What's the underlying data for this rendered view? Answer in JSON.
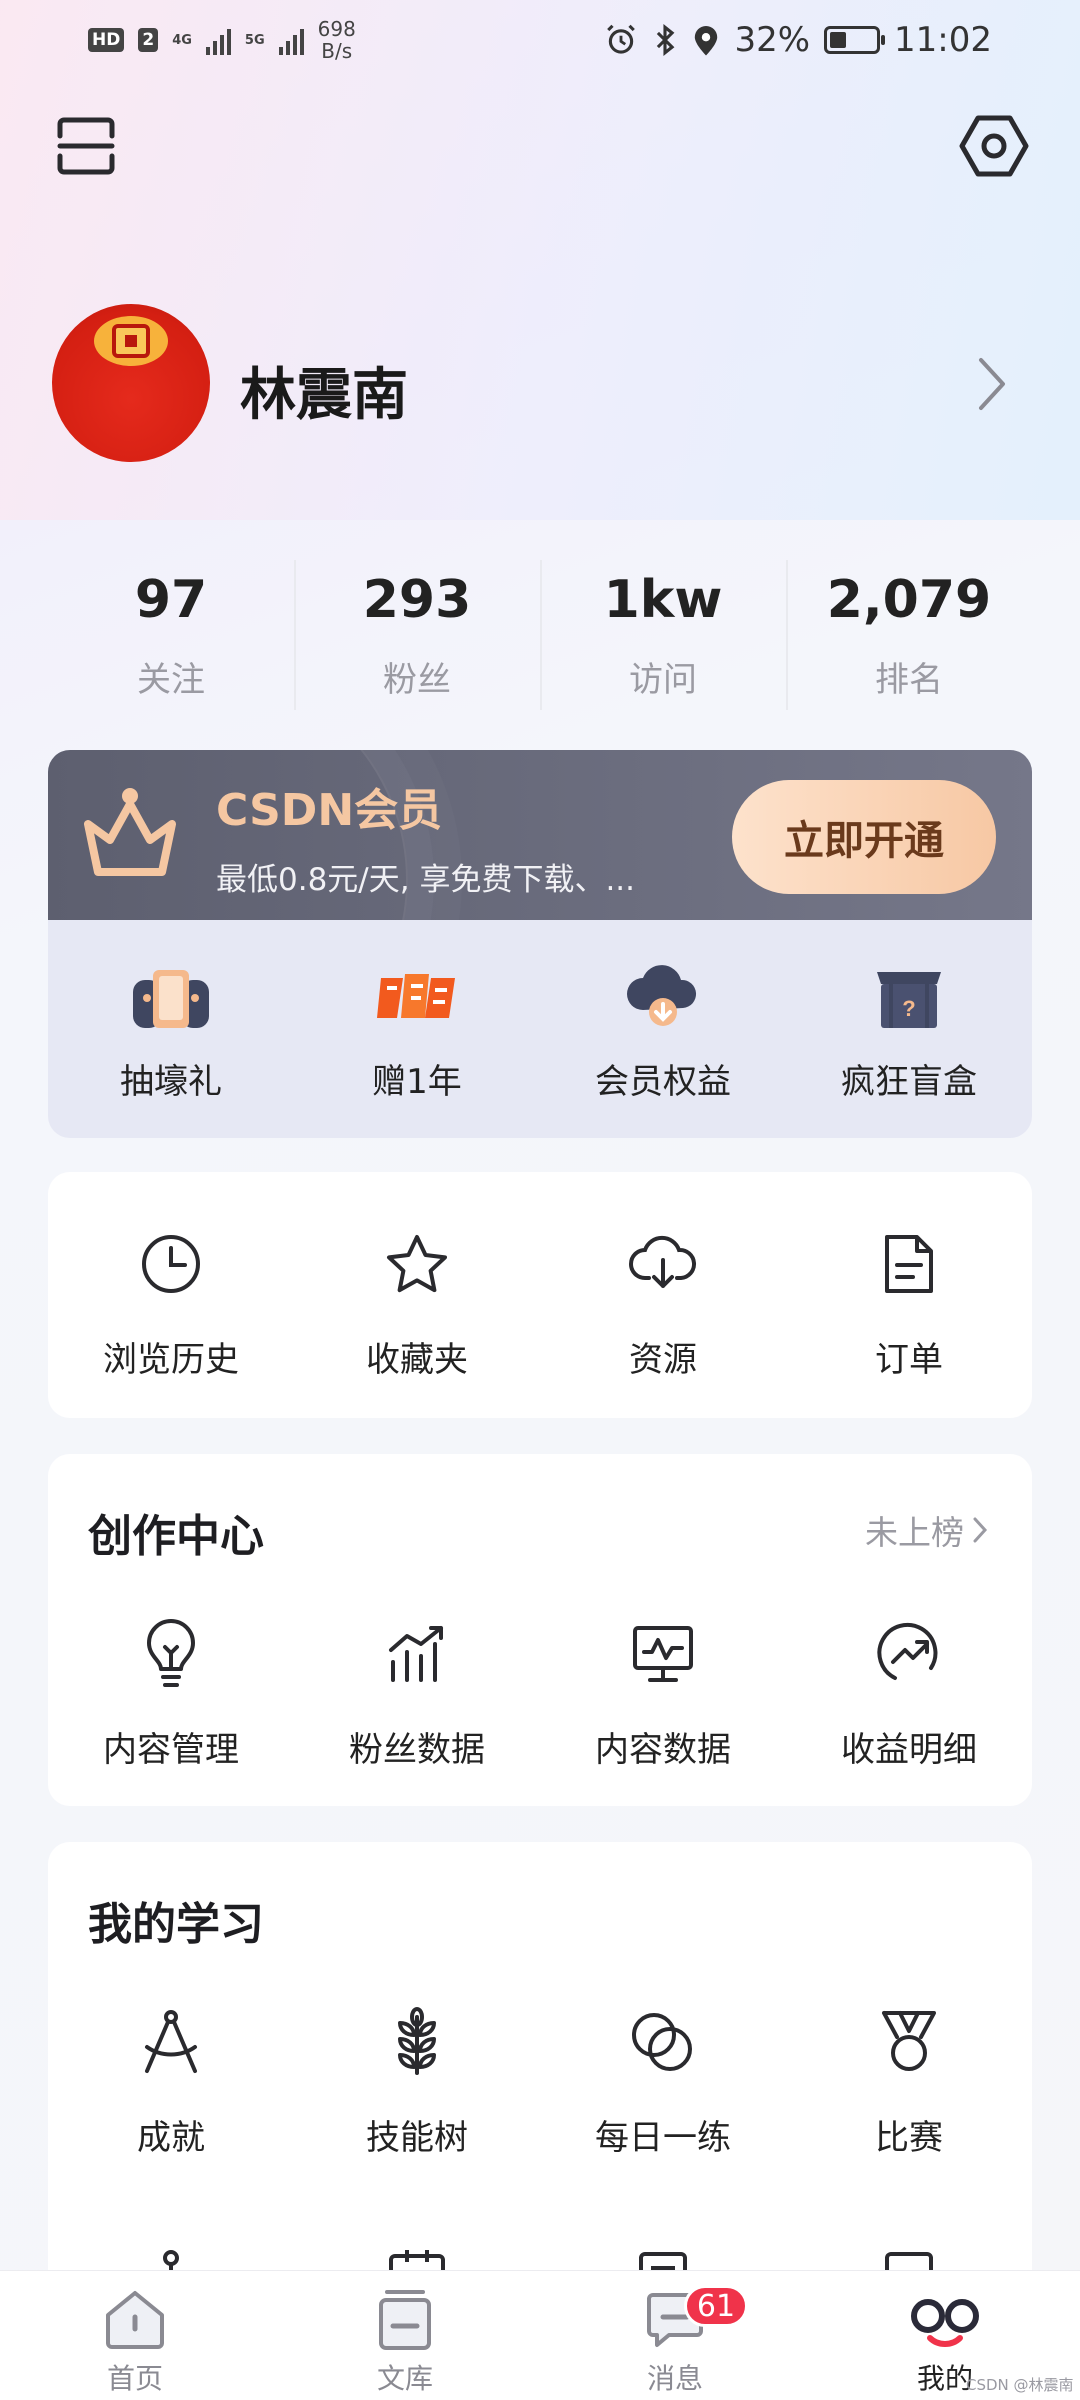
{
  "status_bar": {
    "hd": "HD",
    "sim": "2",
    "net1": "4G",
    "net2": "5G",
    "speed_value": "698",
    "speed_unit": "B/s",
    "battery": "32%",
    "battery_level": 0.32,
    "time": "11:02"
  },
  "profile": {
    "username": "林震南"
  },
  "stats": [
    {
      "value": "97",
      "label": "关注"
    },
    {
      "value": "293",
      "label": "粉丝"
    },
    {
      "value": "1kw",
      "label": "访问"
    },
    {
      "value": "2,079",
      "label": "排名"
    }
  ],
  "member": {
    "title": "CSDN会员",
    "subtitle": "最低0.8元/天, 享免费下载、...",
    "button": "立即开通",
    "perks": [
      {
        "label": "抽壕礼",
        "icon": "game-controller-icon"
      },
      {
        "label": "赠1年",
        "icon": "gift-text-icon"
      },
      {
        "label": "会员权益",
        "icon": "cloud-download-icon"
      },
      {
        "label": "疯狂盲盒",
        "icon": "mystery-box-icon"
      }
    ]
  },
  "shortcuts": [
    {
      "label": "浏览历史",
      "icon": "clock-icon"
    },
    {
      "label": "收藏夹",
      "icon": "star-icon"
    },
    {
      "label": "资源",
      "icon": "cloud-download-icon"
    },
    {
      "label": "订单",
      "icon": "document-icon"
    }
  ],
  "creation": {
    "title": "创作中心",
    "more": "未上榜",
    "items": [
      {
        "label": "内容管理",
        "icon": "lightbulb-icon"
      },
      {
        "label": "粉丝数据",
        "icon": "bar-chart-icon"
      },
      {
        "label": "内容数据",
        "icon": "monitor-chart-icon"
      },
      {
        "label": "收益明细",
        "icon": "trend-circle-icon"
      }
    ]
  },
  "learning": {
    "title": "我的学习",
    "items": [
      {
        "label": "成就",
        "icon": "compass-icon"
      },
      {
        "label": "技能树",
        "icon": "wheat-icon"
      },
      {
        "label": "每日一练",
        "icon": "circles-icon"
      },
      {
        "label": "比赛",
        "icon": "medal-icon"
      }
    ]
  },
  "tabbar": [
    {
      "label": "首页",
      "icon": "home-icon"
    },
    {
      "label": "文库",
      "icon": "library-icon"
    },
    {
      "label": "消息",
      "icon": "message-icon",
      "badge": "61"
    },
    {
      "label": "我的",
      "icon": "profile-icon"
    }
  ],
  "watermark": "CSDN @林震南",
  "colors": {
    "accent_red": "#f0334a",
    "member_gold": "#f5c7a2",
    "icon_dark": "#2a2a2e"
  }
}
